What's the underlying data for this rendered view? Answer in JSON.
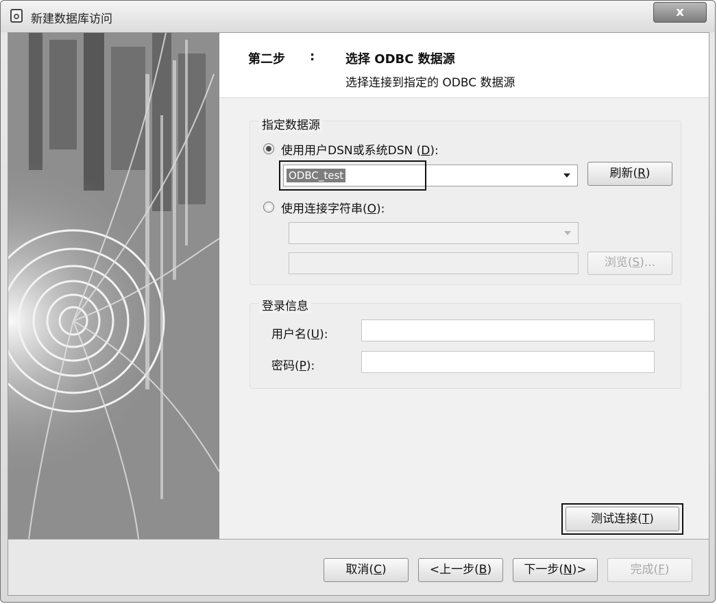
{
  "window": {
    "title": "新建数据库访问",
    "close_label": "x"
  },
  "header": {
    "step_label": "第二步",
    "step_colon": ":",
    "step_title": "选择 ODBC 数据源",
    "step_description": "选择连接到指定的 ODBC 数据源"
  },
  "datasource_group": {
    "title": "指定数据源",
    "use_dsn_label": "使用用户DSN或系统DSN",
    "use_dsn_mnemonic_open": " (",
    "use_dsn_mnemonic": "D",
    "use_dsn_mnemonic_close": "):",
    "use_dsn_checked": true,
    "dsn_value": "ODBC_test",
    "refresh_button": "刷新",
    "refresh_mnemonic": "R",
    "use_connstr_label": "使用连接字符串",
    "use_connstr_mnemonic": "O",
    "use_connstr_checked": false,
    "browse_button": "浏览",
    "browse_mnemonic": "S",
    "browse_suffix": "..."
  },
  "login_group": {
    "title": "登录信息",
    "username_label": "用户名",
    "username_mnemonic": "U",
    "username_value": "",
    "password_label": "密码",
    "password_mnemonic": "P",
    "password_value": ""
  },
  "test_button": {
    "label": "测试连接",
    "mnemonic": "T"
  },
  "footer": {
    "cancel_label": "取消",
    "cancel_mnemonic": "C",
    "back_label": "<上一步",
    "back_mnemonic": "B",
    "next_label": "下一步",
    "next_mnemonic": "N",
    "next_suffix": ">",
    "finish_label": "完成",
    "finish_mnemonic": "F"
  },
  "colors": {
    "selection": "#7d7d7d",
    "disabled_text": "#a8a8a8"
  },
  "icons": [
    "app-icon",
    "close-icon",
    "radio-icon",
    "dropdown-arrow-icon"
  ]
}
